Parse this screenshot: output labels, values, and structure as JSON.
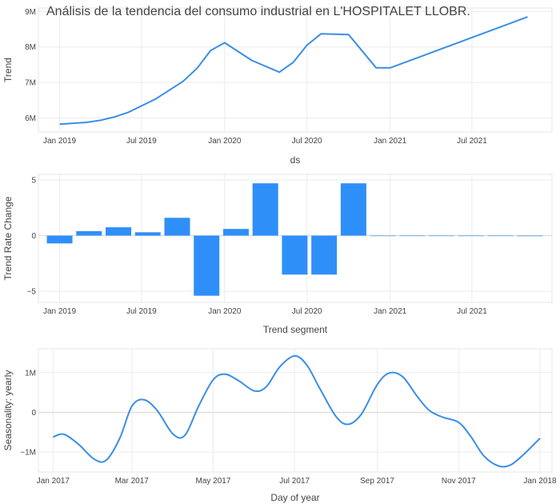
{
  "title": "Análisis de la tendencia del consumo industrial en L'HOSPITALET LLOBR.",
  "colors": {
    "line": "#3a8ee6",
    "bar": "#2f8ff9",
    "grid": "#ebebeb"
  },
  "chart_data": [
    {
      "type": "line",
      "name": "trend",
      "xlabel": "ds",
      "ylabel": "Trend",
      "xlim": [
        "2018-11-15",
        "2021-12-25"
      ],
      "ylim": [
        5600000,
        9100000
      ],
      "grid": true,
      "x_ticks": [
        {
          "at": "2019-01-01",
          "label": "Jan 2019"
        },
        {
          "at": "2019-07-01",
          "label": "Jul 2019"
        },
        {
          "at": "2020-01-01",
          "label": "Jan 2020"
        },
        {
          "at": "2020-07-01",
          "label": "Jul 2020"
        },
        {
          "at": "2021-01-01",
          "label": "Jan 2021"
        },
        {
          "at": "2021-07-01",
          "label": "Jul 2021"
        }
      ],
      "y_ticks": [
        {
          "at": 6000000,
          "label": "6M"
        },
        {
          "at": 7000000,
          "label": "7M"
        },
        {
          "at": 8000000,
          "label": "8M"
        },
        {
          "at": 9000000,
          "label": "9M"
        }
      ],
      "x": [
        "2019-01-01",
        "2019-03-01",
        "2019-04-01",
        "2019-05-01",
        "2019-06-01",
        "2019-08-01",
        "2019-10-01",
        "2019-11-01",
        "2019-12-01",
        "2020-01-01",
        "2020-03-01",
        "2020-05-01",
        "2020-06-01",
        "2020-07-01",
        "2020-08-01",
        "2020-10-01",
        "2020-12-01",
        "2021-01-01",
        "2021-11-01"
      ],
      "y": [
        5820000,
        5870000,
        5930000,
        6020000,
        6150000,
        6530000,
        7030000,
        7400000,
        7900000,
        8120000,
        7620000,
        7290000,
        7570000,
        8050000,
        8370000,
        8350000,
        7410000,
        7410000,
        8850000
      ]
    },
    {
      "type": "bar",
      "name": "trend_rate_change",
      "xlabel": "Trend segment",
      "ylabel": "Trend Rate Change",
      "xlim": [
        "2018-11-15",
        "2021-12-25"
      ],
      "ylim": [
        -6,
        5.5
      ],
      "grid": true,
      "x_ticks": [
        {
          "at": "2019-01-01",
          "label": "Jan 2019"
        },
        {
          "at": "2019-07-01",
          "label": "Jul 2019"
        },
        {
          "at": "2020-01-01",
          "label": "Jan 2020"
        },
        {
          "at": "2020-07-01",
          "label": "Jul 2020"
        },
        {
          "at": "2021-01-01",
          "label": "Jan 2021"
        },
        {
          "at": "2021-07-01",
          "label": "Jul 2021"
        }
      ],
      "y_ticks": [
        {
          "at": -5,
          "label": "−5"
        },
        {
          "at": 0,
          "label": "0"
        },
        {
          "at": 5,
          "label": "5"
        }
      ],
      "x": [
        "2019-01-01",
        "2019-03-07",
        "2019-05-11",
        "2019-07-15",
        "2019-09-18",
        "2019-11-22",
        "2020-01-26",
        "2020-03-31",
        "2020-06-04",
        "2020-08-08",
        "2020-10-12",
        "2020-12-16",
        "2021-02-19",
        "2021-04-25",
        "2021-06-29",
        "2021-09-02",
        "2021-11-06"
      ],
      "values": [
        -0.7,
        0.4,
        0.75,
        0.3,
        1.6,
        -5.4,
        0.6,
        4.7,
        -3.5,
        -3.5,
        4.7,
        0,
        0,
        0,
        0,
        0,
        -0.05
      ]
    },
    {
      "type": "line",
      "name": "seasonality_yearly",
      "xlabel": "Day of year",
      "ylabel": "Seasonality: yearly",
      "xlim": [
        "2016-12-21",
        "2018-01-10"
      ],
      "ylim": [
        -1500000,
        1600000
      ],
      "grid": true,
      "x_ticks": [
        {
          "at": "2017-01-01",
          "label": "Jan 2017"
        },
        {
          "at": "2017-03-01",
          "label": "Mar 2017"
        },
        {
          "at": "2017-05-01",
          "label": "May 2017"
        },
        {
          "at": "2017-07-01",
          "label": "Jul 2017"
        },
        {
          "at": "2017-09-01",
          "label": "Sep 2017"
        },
        {
          "at": "2017-11-01",
          "label": "Nov 2017"
        },
        {
          "at": "2018-01-01",
          "label": "Jan 2018"
        }
      ],
      "y_ticks": [
        {
          "at": -1000000,
          "label": "−1M"
        },
        {
          "at": 0,
          "label": "0"
        },
        {
          "at": 1000000,
          "label": "1M"
        }
      ],
      "x": [
        "2017-01-01",
        "2017-01-09",
        "2017-01-20",
        "2017-02-01",
        "2017-02-10",
        "2017-02-20",
        "2017-03-01",
        "2017-03-10",
        "2017-03-20",
        "2017-04-01",
        "2017-04-10",
        "2017-04-20",
        "2017-05-01",
        "2017-05-10",
        "2017-05-20",
        "2017-06-01",
        "2017-06-10",
        "2017-06-20",
        "2017-07-01",
        "2017-07-10",
        "2017-07-20",
        "2017-08-01",
        "2017-08-10",
        "2017-08-20",
        "2017-09-01",
        "2017-09-10",
        "2017-09-20",
        "2017-10-01",
        "2017-10-10",
        "2017-10-20",
        "2017-11-01",
        "2017-11-10",
        "2017-11-20",
        "2017-12-01",
        "2017-12-10",
        "2017-12-20",
        "2018-01-01"
      ],
      "y": [
        -620000,
        -550000,
        -800000,
        -1180000,
        -1200000,
        -650000,
        150000,
        320000,
        50000,
        -550000,
        -570000,
        150000,
        820000,
        960000,
        800000,
        540000,
        650000,
        1150000,
        1420000,
        1200000,
        600000,
        -100000,
        -300000,
        -50000,
        700000,
        990000,
        900000,
        400000,
        50000,
        -120000,
        -250000,
        -600000,
        -1100000,
        -1350000,
        -1320000,
        -1050000,
        -650000
      ]
    }
  ]
}
